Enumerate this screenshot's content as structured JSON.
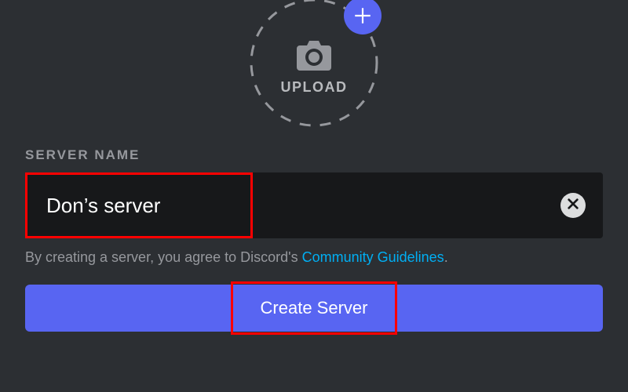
{
  "upload": {
    "label": "UPLOAD"
  },
  "server_name": {
    "label": "SERVER NAME",
    "value": "Don’s server"
  },
  "guidelines": {
    "prefix": "By creating a server, you agree to Discord's ",
    "link_text": "Community Guidelines",
    "suffix": "."
  },
  "create_button": {
    "label": "Create Server"
  },
  "colors": {
    "accent": "#5865F2",
    "link": "#00AFF4",
    "highlight": "#FF0000"
  }
}
